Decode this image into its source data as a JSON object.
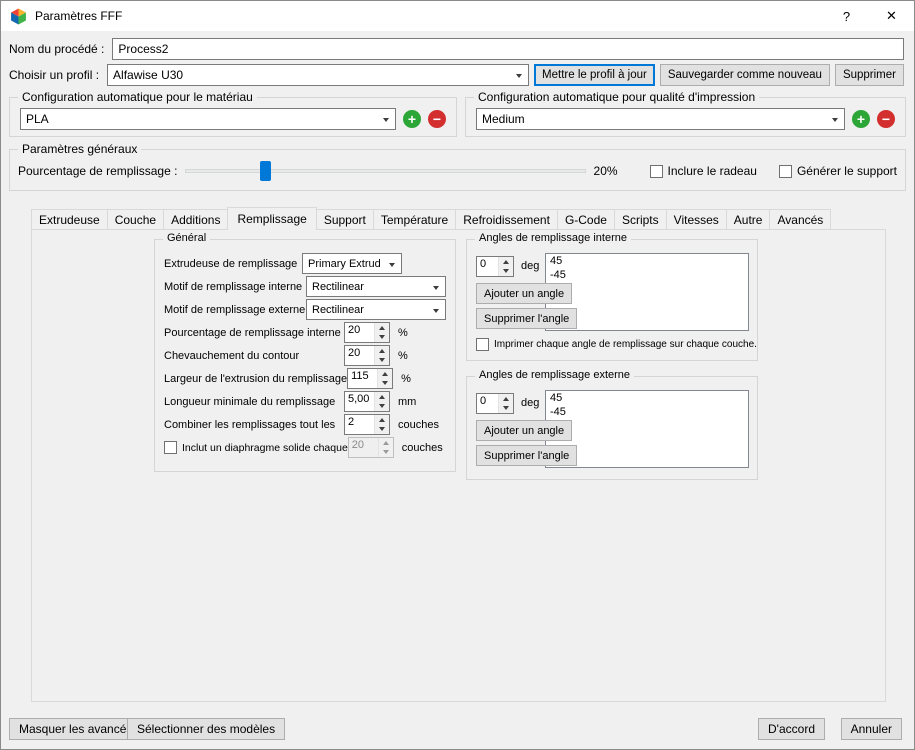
{
  "window": {
    "title": "Paramètres FFF"
  },
  "icons": {
    "help": "?",
    "close": "✕",
    "add": "+",
    "remove": "−"
  },
  "header": {
    "process_name_label": "Nom du procédé :",
    "process_name_value": "Process2",
    "profile_label": "Choisir un profil :",
    "profile_value": "Alfawise U30",
    "buttons": {
      "update_profile": "Mettre le profil à jour",
      "save_as_new": "Sauvegarder comme nouveau",
      "delete": "Supprimer"
    }
  },
  "auto_material": {
    "title": "Configuration automatique pour le matériau",
    "value": "PLA"
  },
  "auto_quality": {
    "title": "Configuration automatique pour qualité d'impression",
    "value": "Medium"
  },
  "general_params": {
    "title": "Paramètres généraux",
    "infill_label": "Pourcentage de remplissage :",
    "infill_percent": "20%",
    "slider_percent": 20,
    "include_raft_label": "Inclure le radeau",
    "generate_support_label": "Générer le support"
  },
  "tabs": [
    "Extrudeuse",
    "Couche",
    "Additions",
    "Remplissage",
    "Support",
    "Température",
    "Refroidissement",
    "G-Code",
    "Scripts",
    "Vitesses",
    "Autre",
    "Avancés"
  ],
  "active_tab": "Remplissage",
  "fill_tab": {
    "general": {
      "title": "Général",
      "extruder_label": "Extrudeuse de remplissage",
      "extruder_value": "Primary Extruder",
      "internal_pattern_label": "Motif de remplissage interne",
      "internal_pattern_value": "Rectilinear",
      "external_pattern_label": "Motif de remplissage externe",
      "external_pattern_value": "Rectilinear",
      "infill_percent_label": "Pourcentage de remplissage interne",
      "infill_percent_value": "20",
      "infill_percent_unit": "%",
      "outline_overlap_label": "Chevauchement du contour",
      "outline_overlap_value": "20",
      "outline_overlap_unit": "%",
      "extrusion_width_label": "Largeur de l'extrusion du remplissage",
      "extrusion_width_value": "115",
      "extrusion_width_unit": "%",
      "min_length_label": "Longueur minimale du remplissage",
      "min_length_value": "5,00",
      "min_length_unit": "mm",
      "combine_label": "Combiner les remplissages tout les",
      "combine_value": "2",
      "combine_unit": "couches",
      "diaphragm_label": "Inclut un diaphragme solide chaque",
      "diaphragm_value": "20",
      "diaphragm_unit": "couches"
    },
    "internal_angles": {
      "title": "Angles de remplissage interne",
      "angle_value": "0",
      "angle_unit": "deg",
      "add_button": "Ajouter un angle",
      "remove_button": "Supprimer l'angle",
      "angles": [
        "45",
        "-45"
      ],
      "per_layer_label": "Imprimer chaque angle de remplissage sur chaque couche."
    },
    "external_angles": {
      "title": "Angles de remplissage externe",
      "angle_value": "0",
      "angle_unit": "deg",
      "add_button": "Ajouter un angle",
      "remove_button": "Supprimer l'angle",
      "angles": [
        "45",
        "-45"
      ]
    }
  },
  "footer": {
    "hide_advanced": "Masquer les avancés",
    "select_models": "Sélectionner des modèles",
    "ok": "D'accord",
    "cancel": "Annuler"
  }
}
